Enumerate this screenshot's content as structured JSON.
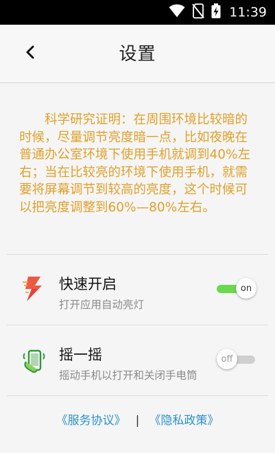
{
  "status_bar": {
    "time": "11:39",
    "icons": [
      "wifi-icon",
      "no-sim-icon",
      "battery-charging-icon"
    ]
  },
  "header": {
    "title": "设置",
    "back_icon": "chevron-left-icon"
  },
  "notice": {
    "text": "科学研究证明：在周围环境比较暗的时候，尽量调节亮度暗一点，比如夜晚在普通办公室环境下使用手机就调到40%左右；当在比较亮的环境下使用手机，就需要将屏幕调节到较高的亮度，这个时候可以把亮度调整到60%—80%左右。"
  },
  "settings": [
    {
      "title": "快速开启",
      "subtitle": "打开应用自动亮灯",
      "icon": "lightning-icon",
      "toggle_label": "on",
      "enabled": true
    },
    {
      "title": "摇一摇",
      "subtitle": "摇动手机以打开和关闭手电筒",
      "icon": "shake-phone-icon",
      "toggle_label": "off",
      "enabled": false
    }
  ],
  "footer": {
    "service_agreement": "《服务协议》",
    "separator": "|",
    "privacy_policy": "《隐私政策》"
  },
  "colors": {
    "notice_text": "#e0a12c",
    "link": "#2a93c9",
    "toggle_on": "#6cd84d",
    "toggle_off": "#cfcfcf"
  }
}
